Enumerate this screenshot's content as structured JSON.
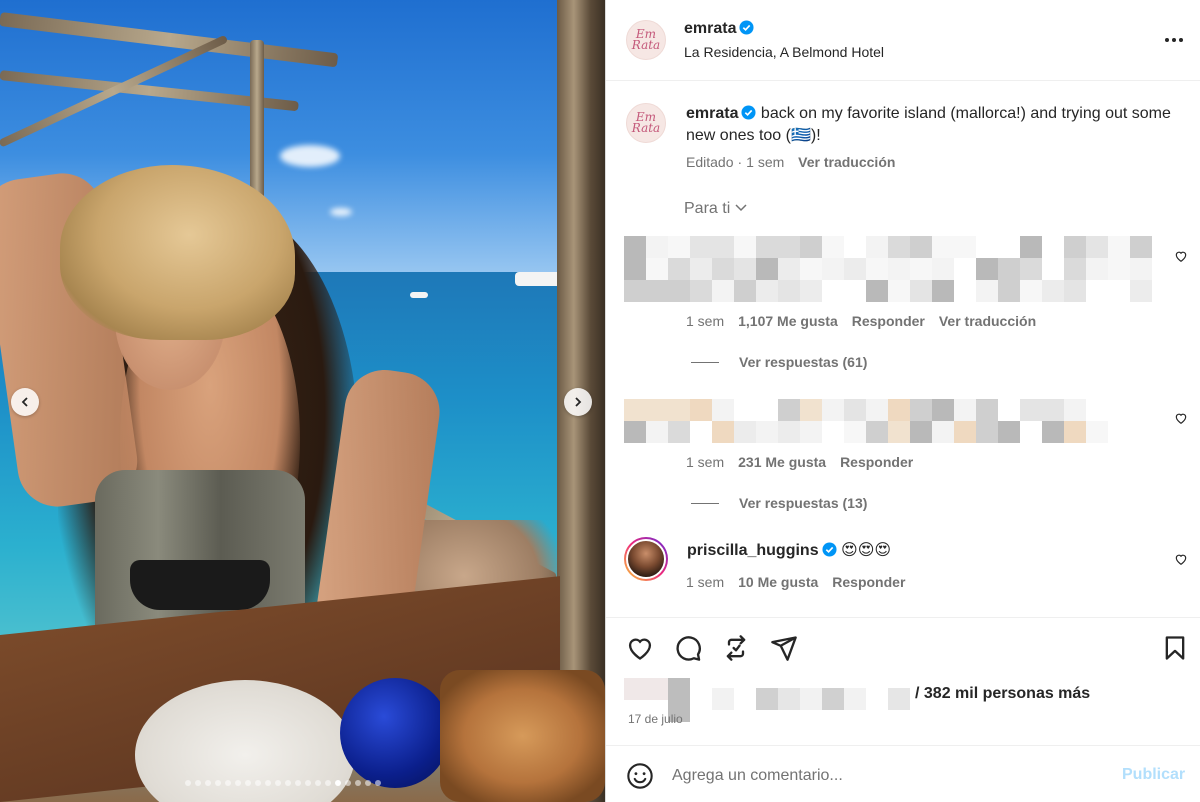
{
  "post": {
    "username": "emrata",
    "location": "La Residencia, A Belmond Hotel",
    "avatar_text_line1": "Em",
    "avatar_text_line2": "Rata"
  },
  "caption": {
    "username": "emrata",
    "text": " back on my favorite island (mallorca!) and trying out some new ones too (🇬🇷)!",
    "edited": "Editado",
    "time": "1 sem",
    "translate": "Ver traducción"
  },
  "sort_filter": {
    "label": "Para ti"
  },
  "comments": [
    {
      "time": "1 sem",
      "likes": "1,107 Me gusta",
      "reply": "Responder",
      "translate": "Ver traducción",
      "view_replies": "Ver respuestas (61)"
    },
    {
      "time": "1 sem",
      "likes": "231 Me gusta",
      "reply": "Responder",
      "view_replies": "Ver respuestas (13)"
    },
    {
      "username": "priscilla_huggins",
      "text": "😍😍😍",
      "time": "1 sem",
      "likes": "10 Me gusta",
      "reply": "Responder"
    }
  ],
  "likes_summary": "/ 382 mil personas más",
  "date": "17 de julio",
  "comment_box": {
    "placeholder": "Agrega un comentario...",
    "publish_label": "Publicar"
  },
  "colors": {
    "verified": "#0095f6",
    "publish_disabled": "#b2dffc",
    "secondary_text": "#737373"
  },
  "carousel": {
    "total_slides": 20,
    "active_slide": 15
  }
}
